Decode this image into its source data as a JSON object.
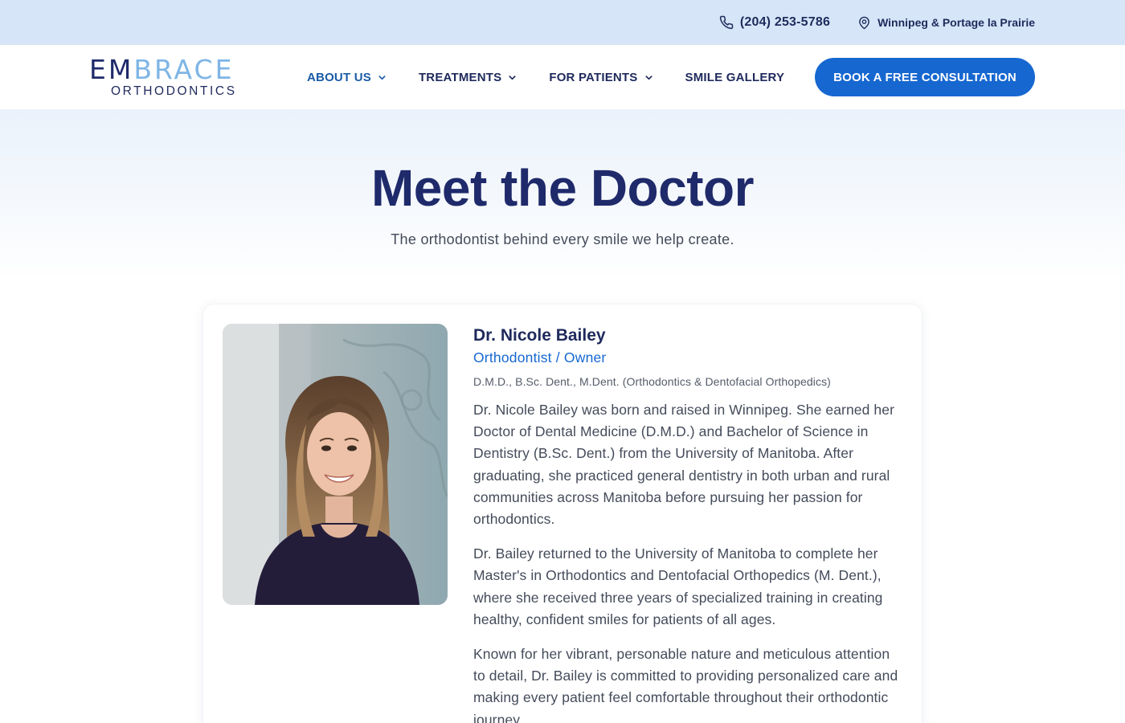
{
  "topbar": {
    "phone": "(204) 253-5786",
    "location": "Winnipeg & Portage la Prairie",
    "phone_icon": "phone-icon",
    "location_icon": "map-pin-icon"
  },
  "header": {
    "logo_primary_a": "EM",
    "logo_primary_b": "BRACE",
    "logo_secondary": "ORTHODONTICS",
    "nav": [
      {
        "label": "ABOUT US",
        "has_dropdown": true,
        "active": true
      },
      {
        "label": "TREATMENTS",
        "has_dropdown": true,
        "active": false
      },
      {
        "label": "FOR PATIENTS",
        "has_dropdown": true,
        "active": false
      },
      {
        "label": "SMILE GALLERY",
        "has_dropdown": false,
        "active": false
      }
    ],
    "cta_label": "BOOK A FREE CONSULTATION"
  },
  "hero": {
    "title": "Meet the Doctor",
    "subtitle": "The orthodontist behind every smile we help create."
  },
  "doctor": {
    "name": "Dr. Nicole Bailey",
    "role": "Orthodontist / Owner",
    "credentials": "D.M.D., B.Sc. Dent., M.Dent. (Orthodontics & Dentofacial Orthopedics)",
    "bio": [
      "Dr. Nicole Bailey was born and raised in Winnipeg. She earned her Doctor of Dental Medicine (D.M.D.) and Bachelor of Science in Dentistry (B.Sc. Dent.) from the University of Manitoba. After graduating, she practiced general dentistry in both urban and rural communities across Manitoba before pursuing her passion for orthodontics.",
      "Dr. Bailey returned to the University of Manitoba to complete her Master's in Orthodontics and Dentofacial Orthopedics (M. Dent.), where she received three years of specialized training in creating healthy, confident smiles for patients of all ages.",
      "Known for her vibrant, personable nature and meticulous attention to detail, Dr. Bailey is committed to providing personalized care and making every patient feel comfortable throughout their orthodontic journey."
    ]
  },
  "colors": {
    "topbar_bg": "#d6e6f8",
    "navy": "#1f2a6b",
    "accent_blue": "#1667d0",
    "logo_light_blue": "#7fb5e6",
    "body_text": "#444b5a"
  }
}
